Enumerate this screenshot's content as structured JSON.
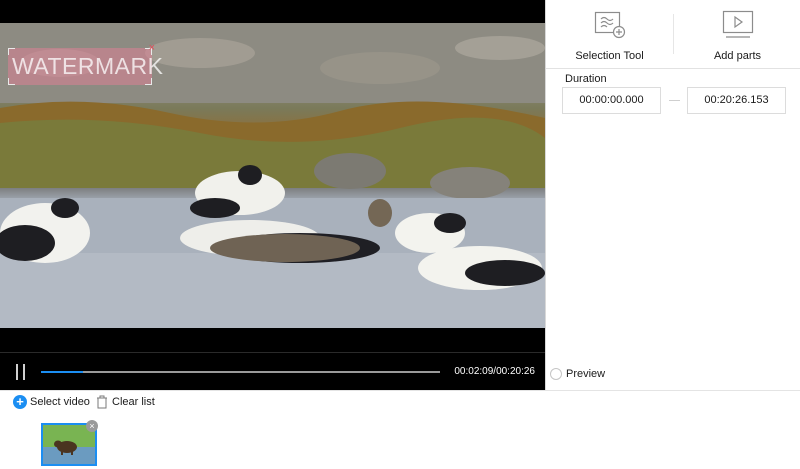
{
  "video": {
    "watermark_text": "WATERMARK",
    "watermark_close": "×",
    "current_time": "00:02:09",
    "total_time": "00:20:26",
    "time_display": "00:02:09/00:20:26",
    "progress_fraction": 0.105
  },
  "tools": {
    "selection_label": "Selection Tool",
    "add_parts_label": "Add parts"
  },
  "duration": {
    "label": "Duration",
    "start": "00:00:00.000",
    "end": "00:20:26.153"
  },
  "preview": {
    "label": "Preview",
    "checked": false
  },
  "list": {
    "select_label": "Select video",
    "clear_label": "Clear list",
    "thumb_remove": "×"
  },
  "colors": {
    "accent": "#1b8ef2",
    "watermark_overlay": "#dc8296"
  },
  "icons": {
    "selection": "selection-tool-icon",
    "add_parts": "add-parts-icon",
    "pause": "pause-icon",
    "select": "plus-circle-icon",
    "clear": "trash-icon"
  }
}
